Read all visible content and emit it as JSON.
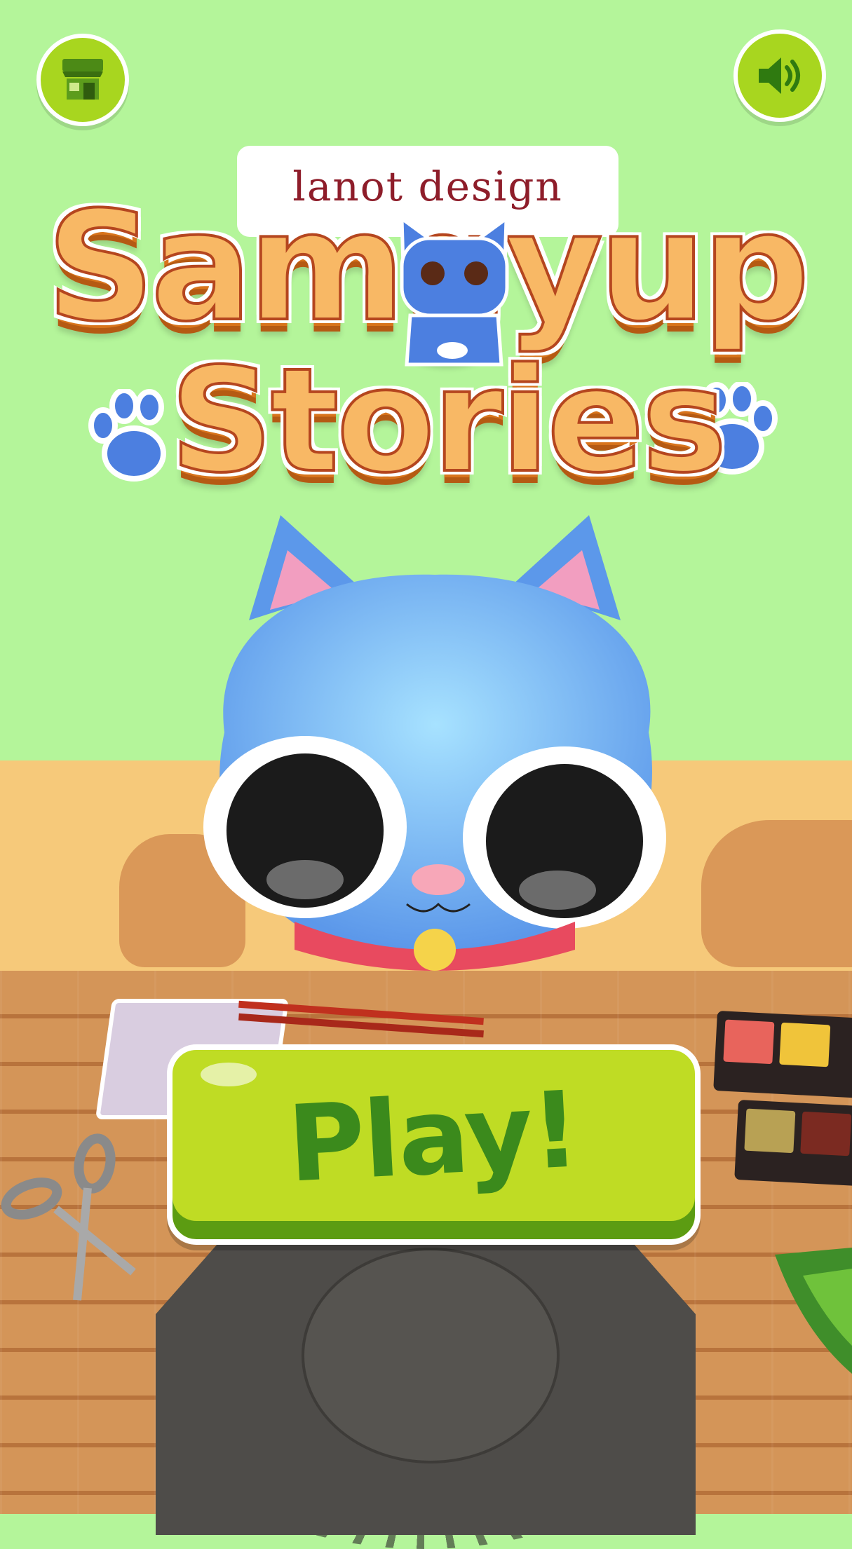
{
  "header": {
    "shop_button": {
      "icon": "shop-icon"
    },
    "sound_button": {
      "icon": "speaker-icon"
    }
  },
  "logo": {
    "brand": "lanot design",
    "title_line1": "Samgyup",
    "title_line2": "Stories"
  },
  "main": {
    "play_label": "Play!"
  },
  "colors": {
    "wall": "#b4f59a",
    "button_green": "#a8d61f",
    "play_text": "#3b8a1c",
    "logo_fill": "#f8b865",
    "logo_outline": "#b5461f"
  }
}
